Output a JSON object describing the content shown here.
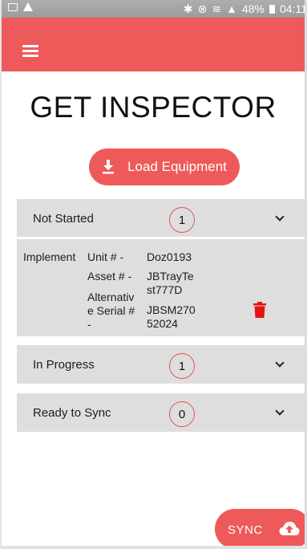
{
  "status_bar": {
    "bluetooth": "✱",
    "battery": "48%",
    "time": "04:11"
  },
  "app_bar": {
    "menu_icon": "hamburger-menu-icon",
    "color": "#ee5a5a"
  },
  "title": "GET INSPECTOR",
  "load_button": {
    "label": "Load Equipment",
    "icon": "download-icon"
  },
  "sections": {
    "not_started": {
      "label": "Not Started",
      "count": "1"
    },
    "in_progress": {
      "label": "In Progress",
      "count": "1"
    },
    "ready_to_sync": {
      "label": "Ready to Sync",
      "count": "0"
    }
  },
  "equipment": {
    "type": "Implement",
    "fields": [
      {
        "label": "Unit # -",
        "value": "Doz0193"
      },
      {
        "label": "Asset # -",
        "value": "JBTrayTest777D"
      },
      {
        "label": "Alternative Serial # -",
        "value": "JBSM27052024"
      }
    ],
    "delete_icon": "trash-icon",
    "delete_color": "#e8130f"
  },
  "sync_button": {
    "label": "SYNC",
    "icon": "cloud-upload-icon"
  },
  "colors": {
    "accent": "#ee5a5a",
    "section_bg": "#dedede",
    "badge_border": "#e25656"
  }
}
